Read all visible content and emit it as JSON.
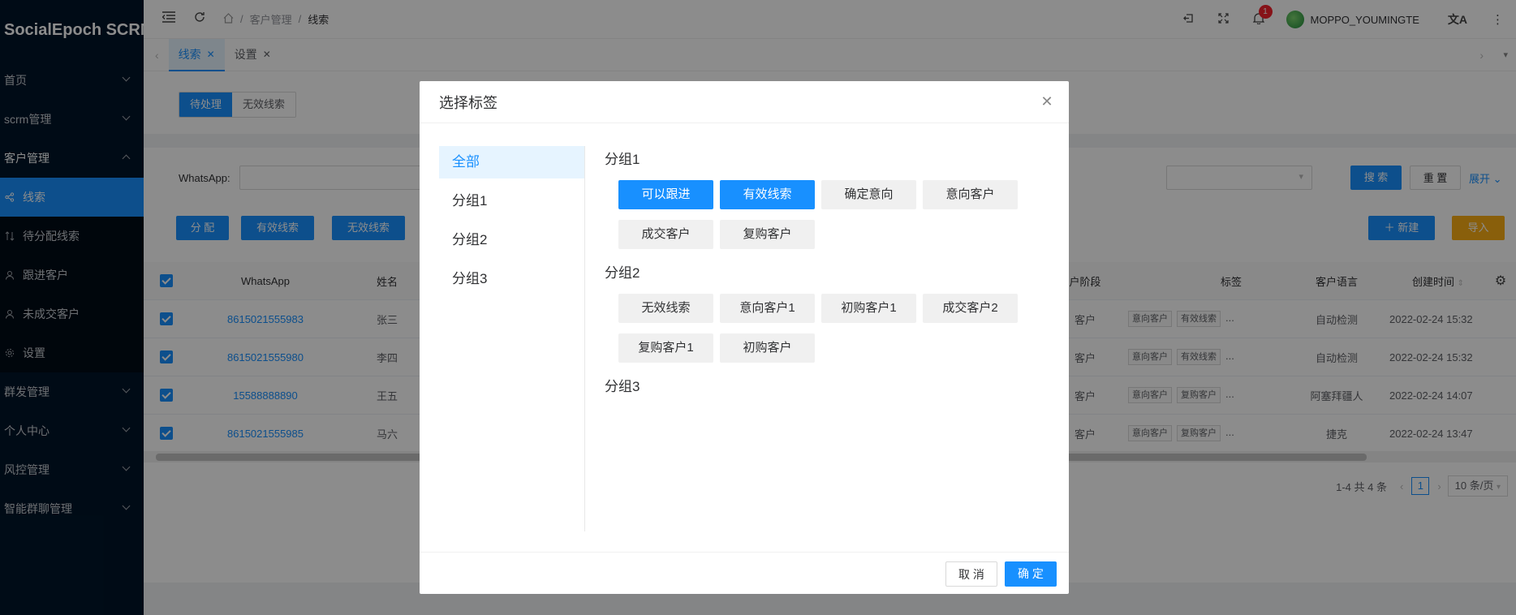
{
  "app": {
    "title": "SocialEpoch SCRM"
  },
  "sidebar": {
    "items": [
      {
        "label": "首页"
      },
      {
        "label": "scrm管理"
      },
      {
        "label": "客户管理"
      },
      {
        "label": "群发管理"
      },
      {
        "label": "个人中心"
      },
      {
        "label": "风控管理"
      },
      {
        "label": "智能群聊管理"
      }
    ],
    "sub": [
      {
        "label": "线索",
        "icon": "share-icon"
      },
      {
        "label": "待分配线索",
        "icon": "transfer-icon"
      },
      {
        "label": "跟进客户",
        "icon": "user-icon"
      },
      {
        "label": "未成交客户",
        "icon": "user-icon"
      },
      {
        "label": "设置",
        "icon": "gear-icon"
      }
    ]
  },
  "header": {
    "breadcrumb": [
      "客户管理",
      "线索"
    ],
    "badge_count": "1",
    "username": "MOPPO_YOUMINGTE"
  },
  "tabs": [
    {
      "label": "线索"
    },
    {
      "label": "设置"
    }
  ],
  "page": {
    "segment": [
      "待处理",
      "无效线索"
    ],
    "filter_label": "WhatsApp:",
    "search_label": "搜 索",
    "reset_label": "重 置",
    "expand_label": "展开",
    "actions": [
      "分 配",
      "有效线索",
      "无效线索"
    ],
    "new_label": "新建",
    "import_label": "导入"
  },
  "table": {
    "headers": {
      "whatsapp": "WhatsApp",
      "name": "姓名",
      "stage": "户阶段",
      "tags": "标签",
      "lang": "客户语言",
      "created": "创建时间"
    },
    "rows": [
      {
        "whatsapp": "8615021555983",
        "name": "张三",
        "stage": "客户",
        "tag1": "意向客户",
        "tag2": "有效线索",
        "more": "...",
        "lang": "自动检测",
        "created": "2022-02-24 15:32"
      },
      {
        "whatsapp": "8615021555980",
        "name": "李四",
        "stage": "客户",
        "tag1": "意向客户",
        "tag2": "有效线索",
        "more": "...",
        "lang": "自动检测",
        "created": "2022-02-24 15:32"
      },
      {
        "whatsapp": "15588888890",
        "name": "王五",
        "stage": "客户",
        "tag1": "意向客户",
        "tag2": "复购客户",
        "more": "...",
        "lang": "阿塞拜疆人",
        "created": "2022-02-24 14:07"
      },
      {
        "whatsapp": "8615021555985",
        "name": "马六",
        "stage": "客户",
        "tag1": "意向客户",
        "tag2": "复购客户",
        "more": "...",
        "lang": "捷克",
        "created": "2022-02-24 13:47"
      }
    ]
  },
  "pagination": {
    "total": "1-4 共 4 条",
    "current": "1",
    "size": "10 条/页"
  },
  "dialog": {
    "title": "选择标签",
    "nav": [
      "全部",
      "分组1",
      "分组2",
      "分组3"
    ],
    "groups": [
      {
        "title": "分组1",
        "chips": [
          {
            "label": "可以跟进",
            "selected": true
          },
          {
            "label": "有效线索",
            "selected": true
          },
          {
            "label": "确定意向",
            "selected": false
          },
          {
            "label": "意向客户",
            "selected": false
          },
          {
            "label": "成交客户",
            "selected": false
          },
          {
            "label": "复购客户",
            "selected": false
          }
        ]
      },
      {
        "title": "分组2",
        "chips": [
          {
            "label": "无效线索",
            "selected": false
          },
          {
            "label": "意向客户1",
            "selected": false
          },
          {
            "label": "初购客户1",
            "selected": false
          },
          {
            "label": "成交客户2",
            "selected": false
          },
          {
            "label": "复购客户1",
            "selected": false
          },
          {
            "label": "初购客户",
            "selected": false
          }
        ]
      },
      {
        "title": "分组3",
        "chips": []
      }
    ],
    "cancel_label": "取 消",
    "ok_label": "确 定"
  }
}
